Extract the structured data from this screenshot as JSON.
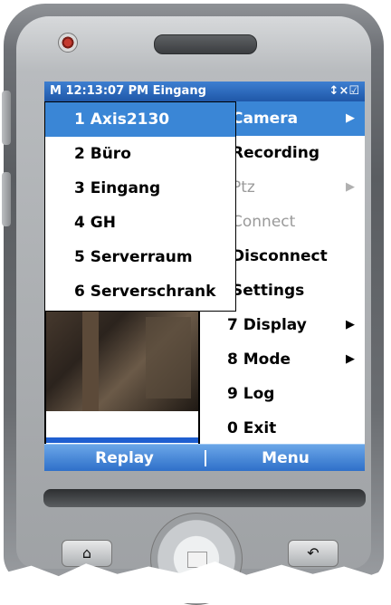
{
  "title_bar": {
    "text": "M 12:13:07 PM Eingang",
    "icons": "↕×☑"
  },
  "main_menu": {
    "items": [
      {
        "label": "Camera",
        "arrow": "▶",
        "state": "selected"
      },
      {
        "label": "Recording",
        "arrow": "",
        "state": "normal"
      },
      {
        "label": "Ptz",
        "arrow": "▶",
        "state": "disabled"
      },
      {
        "label": "Connect",
        "arrow": "",
        "state": "disabled"
      },
      {
        "label": "Disconnect",
        "arrow": "",
        "state": "normal"
      },
      {
        "label": "Settings",
        "arrow": "",
        "state": "normal"
      },
      {
        "label": "7 Display",
        "arrow": "▶",
        "state": "normal"
      },
      {
        "label": "8 Mode",
        "arrow": "▶",
        "state": "normal"
      },
      {
        "label": "9 Log",
        "arrow": "",
        "state": "normal"
      },
      {
        "label": "0 Exit",
        "arrow": "",
        "state": "normal"
      }
    ]
  },
  "camera_submenu": {
    "items": [
      {
        "label": "1 Axis2130",
        "state": "selected"
      },
      {
        "label": "2 Büro",
        "state": "normal"
      },
      {
        "label": "3 Eingang",
        "state": "normal"
      },
      {
        "label": "4 GH",
        "state": "normal"
      },
      {
        "label": "5 Serverraum",
        "state": "normal"
      },
      {
        "label": "6 Serverschrank",
        "state": "normal"
      }
    ]
  },
  "softkeys": {
    "left": "Replay",
    "right": "Menu"
  },
  "hardware_keys": {
    "home_icon": "⌂",
    "back_icon": "↶"
  },
  "colors": {
    "accent": "#3a86d6",
    "titlebar": "#1f57a8",
    "disabled_text": "#9a9a9a"
  }
}
